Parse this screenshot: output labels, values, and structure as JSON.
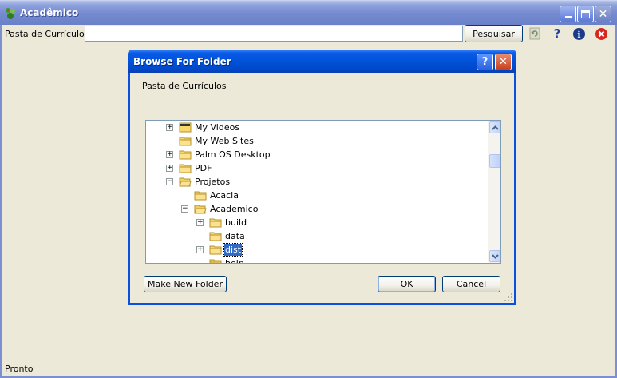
{
  "window": {
    "title": "Acadêmico",
    "title_bar_color": "#7389d0"
  },
  "toolbar": {
    "path_label": "Pasta de Currículos:",
    "path_value": "",
    "search_label": "Pesquisar",
    "icons": [
      "refresh-icon",
      "help-icon",
      "info-icon",
      "exit-icon"
    ],
    "help_glyph": "?",
    "info_glyph": "i"
  },
  "dialog": {
    "title": "Browse For Folder",
    "title_bar_color": "#0052d9",
    "description": "Pasta de Currículos",
    "help_glyph": "?",
    "close_glyph": "✕",
    "tree": [
      {
        "label": "My Videos",
        "expander": "+",
        "icon": "video-folder-icon",
        "selected": false
      },
      {
        "label": "My Web Sites",
        "expander": "",
        "icon": "folder-icon",
        "selected": false
      },
      {
        "label": "Palm OS Desktop",
        "expander": "+",
        "icon": "folder-icon",
        "selected": false
      },
      {
        "label": "PDF",
        "expander": "+",
        "icon": "folder-icon",
        "selected": false
      },
      {
        "label": "Projetos",
        "expander": "−",
        "icon": "open-folder-icon",
        "selected": false
      },
      {
        "label": "Acacia",
        "expander": "",
        "icon": "folder-icon",
        "selected": false
      },
      {
        "label": "Academico",
        "expander": "−",
        "icon": "open-folder-icon",
        "selected": false
      },
      {
        "label": "build",
        "expander": "+",
        "icon": "folder-icon",
        "selected": false
      },
      {
        "label": "data",
        "expander": "",
        "icon": "folder-icon",
        "selected": false
      },
      {
        "label": "dist",
        "expander": "+",
        "icon": "folder-icon",
        "selected": true
      },
      {
        "label": "help",
        "expander": "",
        "icon": "folder-icon",
        "selected": false
      }
    ],
    "buttons": {
      "make_new_folder": "Make New Folder",
      "ok": "OK",
      "cancel": "Cancel"
    },
    "selection_color": "#316ac5"
  },
  "status_bar": {
    "text": "Pronto"
  }
}
